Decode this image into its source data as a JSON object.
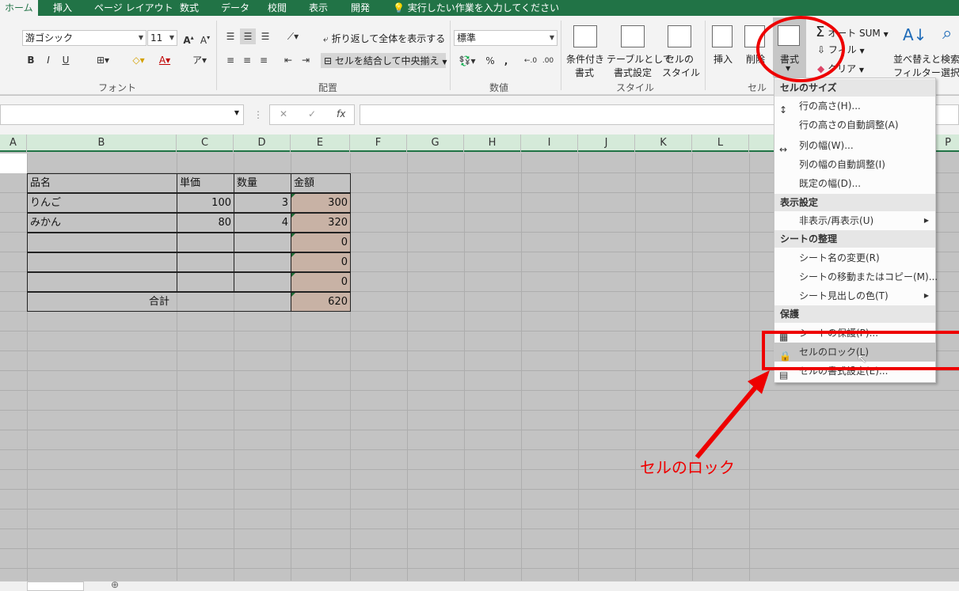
{
  "tabs": [
    "ホーム",
    "挿入",
    "ページ レイアウト",
    "数式",
    "データ",
    "校閲",
    "表示",
    "開発",
    "実行したい作業を入力してください"
  ],
  "ribbon": {
    "font_name": "游ゴシック",
    "font_size": "11",
    "font_buttons": [
      "B",
      "I",
      "U"
    ],
    "wrap_text": "折り返して全体を表示する",
    "merge_center": "セルを結合して中央揃え",
    "number_format": "標準",
    "percent": "%",
    "comma": ",",
    "cond_format": [
      "条件付き",
      "書式"
    ],
    "table_format": [
      "テーブルとして",
      "書式設定"
    ],
    "cell_style": [
      "セルの",
      "スタイル"
    ],
    "insert": "挿入",
    "delete": "削除",
    "format": "書式",
    "autosum": "オート SUM",
    "fill": "フィル",
    "clear": "クリア",
    "sort_filter": [
      "並べ替えと",
      "フィルター"
    ],
    "find_select": [
      "検索",
      "選択"
    ],
    "groups": {
      "font": "フォント",
      "alignment": "配置",
      "number": "数値",
      "styles": "スタイル",
      "cells": "セル"
    }
  },
  "formula_bar": {
    "fx": "fx",
    "cancel": "✕",
    "enter": "✓"
  },
  "columns": [
    "A",
    "B",
    "C",
    "D",
    "E",
    "F",
    "G",
    "H",
    "I",
    "J",
    "K",
    "L",
    "P"
  ],
  "table": {
    "headers": [
      "品名",
      "単価",
      "数量",
      "金額"
    ],
    "rows": [
      [
        "りんご",
        "100",
        "3",
        "300"
      ],
      [
        "みかん",
        "80",
        "4",
        "320"
      ],
      [
        "",
        "",
        "",
        "0"
      ],
      [
        "",
        "",
        "",
        "0"
      ],
      [
        "",
        "",
        "",
        "0"
      ]
    ],
    "total_label": "合計",
    "total_value": "620"
  },
  "menu": {
    "sections": [
      {
        "header": "セルのサイズ",
        "items": [
          "行の高さ(H)...",
          "行の高さの自動調整(A)",
          "列の幅(W)...",
          "列の幅の自動調整(I)",
          "既定の幅(D)..."
        ]
      },
      {
        "header": "表示設定",
        "items": [
          "非表示/再表示(U)"
        ]
      },
      {
        "header": "シートの整理",
        "items": [
          "シート名の変更(R)",
          "シートの移動またはコピー(M)...",
          "シート見出しの色(T)"
        ]
      },
      {
        "header": "保護",
        "items": [
          "シートの保護(P)...",
          "セルのロック(L)",
          "セルの書式設定(E)..."
        ]
      }
    ]
  },
  "annotation": {
    "label": "セルのロック",
    "color": "#ee0000"
  },
  "colors": {
    "accent": "#217346",
    "calc_fill": "#c8b2a5",
    "annotation": "#ee0000"
  }
}
